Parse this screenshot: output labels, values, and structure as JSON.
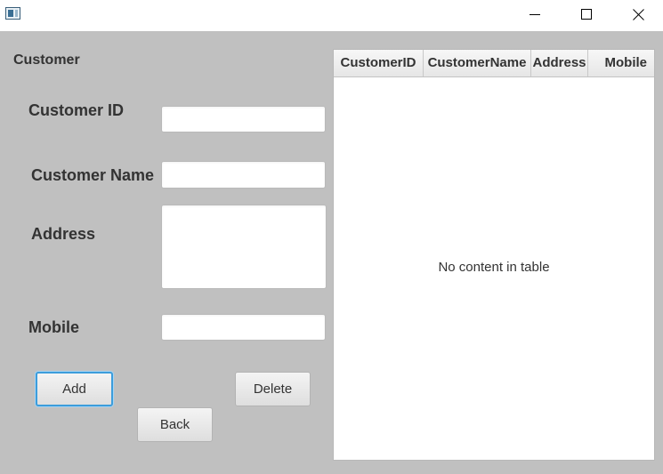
{
  "window": {
    "minimize_icon": "minimize-icon",
    "maximize_icon": "maximize-icon",
    "close_icon": "close-icon"
  },
  "form": {
    "heading": "Customer",
    "customer_id_label": "Customer ID",
    "customer_id_value": "",
    "customer_name_label": "Customer Name",
    "customer_name_value": "",
    "address_label": "Address",
    "address_value": "",
    "mobile_label": "Mobile",
    "mobile_value": ""
  },
  "buttons": {
    "add": "Add",
    "delete": "Delete",
    "back": "Back"
  },
  "table": {
    "columns": [
      "CustomerID",
      "CustomerName",
      "Address",
      "Mobile"
    ],
    "rows": [],
    "placeholder": "No content in table"
  },
  "colors": {
    "background": "#c0c0c0",
    "focus_ring": "#3c9ddc"
  }
}
